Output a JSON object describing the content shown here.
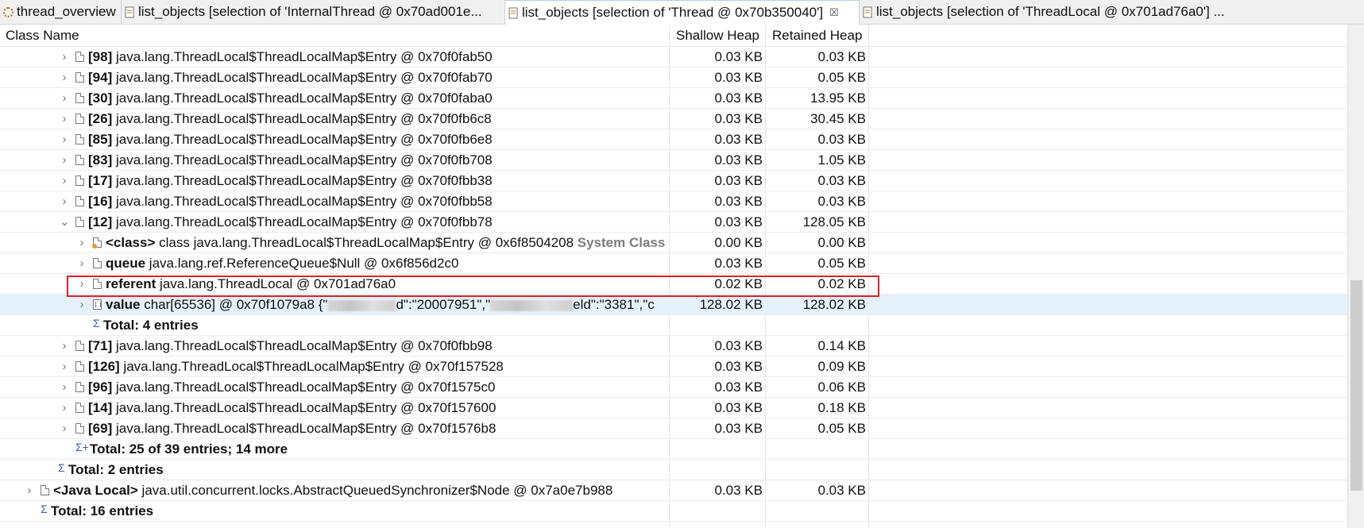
{
  "tabs": [
    {
      "label": "thread_overview",
      "active": false,
      "icon": "gear-icon"
    },
    {
      "label": "list_objects  [selection of 'InternalThread @ 0x70ad001e...",
      "active": false,
      "icon": "document-icon"
    },
    {
      "label": "list_objects  [selection of 'Thread @ 0x70b350040']",
      "active": true,
      "icon": "document-icon",
      "close": "☒"
    },
    {
      "label": "list_objects  [selection of 'ThreadLocal @ 0x701ad76a0'] ...",
      "active": false,
      "icon": "document-icon"
    }
  ],
  "columns": {
    "name": "Class Name",
    "shallow": "Shallow Heap",
    "retained": "Retained Heap"
  },
  "rows": [
    {
      "chevron": "›",
      "icon": "object",
      "bold": "[98]",
      "text": " java.lang.ThreadLocal$ThreadLocalMap$Entry @ 0x70f0fab50",
      "shallow": "0.03 KB",
      "retained": "0.03 KB"
    },
    {
      "chevron": "›",
      "icon": "object",
      "bold": "[94]",
      "text": " java.lang.ThreadLocal$ThreadLocalMap$Entry @ 0x70f0fab70",
      "shallow": "0.03 KB",
      "retained": "0.05 KB"
    },
    {
      "chevron": "›",
      "icon": "object",
      "bold": "[30]",
      "text": " java.lang.ThreadLocal$ThreadLocalMap$Entry @ 0x70f0faba0",
      "shallow": "0.03 KB",
      "retained": "13.95 KB"
    },
    {
      "chevron": "›",
      "icon": "object",
      "bold": "[26]",
      "text": " java.lang.ThreadLocal$ThreadLocalMap$Entry @ 0x70f0fb6c8",
      "shallow": "0.03 KB",
      "retained": "30.45 KB"
    },
    {
      "chevron": "›",
      "icon": "object",
      "bold": "[85]",
      "text": " java.lang.ThreadLocal$ThreadLocalMap$Entry @ 0x70f0fb6e8",
      "shallow": "0.03 KB",
      "retained": "0.03 KB"
    },
    {
      "chevron": "›",
      "icon": "object",
      "bold": "[83]",
      "text": " java.lang.ThreadLocal$ThreadLocalMap$Entry @ 0x70f0fb708",
      "shallow": "0.03 KB",
      "retained": "1.05 KB"
    },
    {
      "chevron": "›",
      "icon": "object",
      "bold": "[17]",
      "text": " java.lang.ThreadLocal$ThreadLocalMap$Entry @ 0x70f0fbb38",
      "shallow": "0.03 KB",
      "retained": "0.03 KB"
    },
    {
      "chevron": "›",
      "icon": "object",
      "bold": "[16]",
      "text": " java.lang.ThreadLocal$ThreadLocalMap$Entry @ 0x70f0fbb58",
      "shallow": "0.03 KB",
      "retained": "0.03 KB"
    },
    {
      "chevron": "⌄",
      "icon": "object",
      "bold": "[12]",
      "text": " java.lang.ThreadLocal$ThreadLocalMap$Entry @ 0x70f0fbb78",
      "shallow": "0.03 KB",
      "retained": "128.05 KB"
    },
    {
      "chevron": "›",
      "icon": "class",
      "bold": "<class>",
      "text": " class java.lang.ThreadLocal$ThreadLocalMap$Entry @ 0x6f8504208 ",
      "grey": "System Class",
      "shallow": "0.00 KB",
      "retained": "0.00 KB"
    },
    {
      "chevron": "›",
      "icon": "object",
      "bold": "queue",
      "text": " java.lang.ref.ReferenceQueue$Null @ 0x6f856d2c0",
      "shallow": "0.03 KB",
      "retained": "0.05 KB"
    },
    {
      "chevron": "›",
      "icon": "object",
      "bold": "referent",
      "text": " java.lang.ThreadLocal @ 0x701ad76a0",
      "shallow": "0.02 KB",
      "retained": "0.02 KB"
    },
    {
      "chevron": "›",
      "icon": "array",
      "bold": "value",
      "text": " char[65536] @ 0x70f1079a8  {\"",
      "masked1": "d\":\"20007951\",\"",
      "masked2": "eld\":\"3381\",\"c",
      "selected": true,
      "shallow": "128.02 KB",
      "retained": "128.02 KB"
    },
    {
      "chevron": "",
      "icon": "sigma",
      "bold": "Total: 4 entries",
      "text": "",
      "shallow": "",
      "retained": ""
    },
    {
      "chevron": "›",
      "icon": "object",
      "bold": "[71]",
      "text": " java.lang.ThreadLocal$ThreadLocalMap$Entry @ 0x70f0fbb98",
      "shallow": "0.03 KB",
      "retained": "0.14 KB"
    },
    {
      "chevron": "›",
      "icon": "object",
      "bold": "[126]",
      "text": " java.lang.ThreadLocal$ThreadLocalMap$Entry @ 0x70f157528",
      "shallow": "0.03 KB",
      "retained": "0.09 KB"
    },
    {
      "chevron": "›",
      "icon": "object",
      "bold": "[96]",
      "text": " java.lang.ThreadLocal$ThreadLocalMap$Entry @ 0x70f1575c0",
      "shallow": "0.03 KB",
      "retained": "0.06 KB"
    },
    {
      "chevron": "›",
      "icon": "object",
      "bold": "[14]",
      "text": " java.lang.ThreadLocal$ThreadLocalMap$Entry @ 0x70f157600",
      "shallow": "0.03 KB",
      "retained": "0.18 KB"
    },
    {
      "chevron": "›",
      "icon": "object",
      "bold": "[69]",
      "text": " java.lang.ThreadLocal$ThreadLocalMap$Entry @ 0x70f1576b8",
      "shallow": "0.03 KB",
      "retained": "0.05 KB"
    },
    {
      "chevron": "",
      "icon": "sigma-more",
      "bold": "Total: 25 of 39 entries; 14 more",
      "text": "",
      "shallow": "",
      "retained": ""
    },
    {
      "chevron": "",
      "icon": "sigma",
      "bold": "Total: 2 entries",
      "text": "",
      "shallow": "",
      "retained": ""
    },
    {
      "chevron": "›",
      "icon": "object",
      "bold": "<Java Local>",
      "text": " java.util.concurrent.locks.AbstractQueuedSynchronizer$Node @ 0x7a0e7b988",
      "shallow": "0.03 KB",
      "retained": "0.03 KB"
    },
    {
      "chevron": "",
      "icon": "sigma",
      "bold": "Total: 16 entries",
      "text": "",
      "shallow": "",
      "retained": ""
    }
  ]
}
